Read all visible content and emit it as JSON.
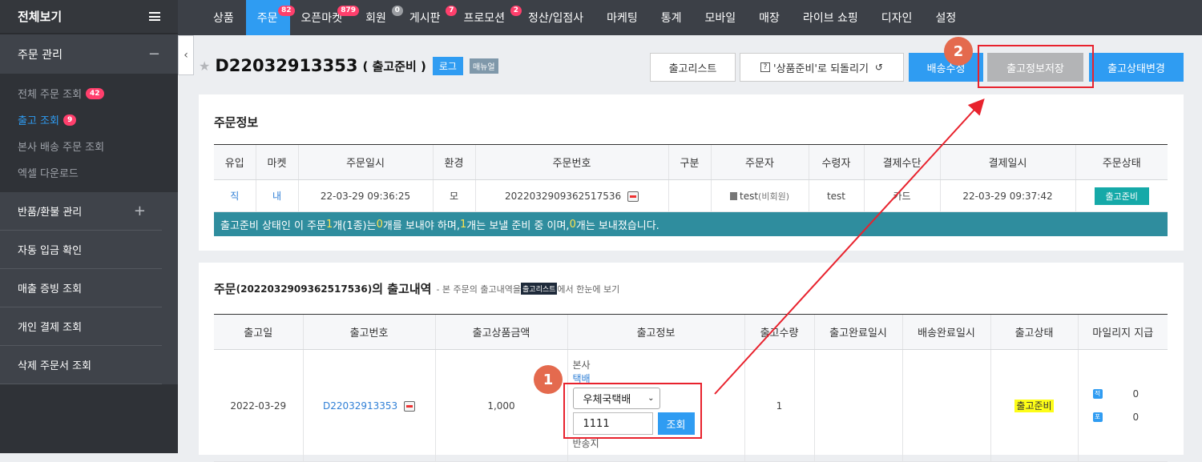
{
  "sidebar": {
    "title": "전체보기",
    "section_order": "주문 관리",
    "section_order_sign": "−",
    "sub_items": [
      {
        "label": "전체 주문 조회",
        "badge": "42"
      },
      {
        "label": "출고 조회",
        "badge": "9"
      },
      {
        "label": "본사 배송 주문 조회",
        "badge": ""
      },
      {
        "label": "엑셀 다운로드",
        "badge": ""
      }
    ],
    "main_items": [
      {
        "label": "반품/환불 관리",
        "sign": "+"
      },
      {
        "label": "자동 입금 확인",
        "sign": ""
      },
      {
        "label": "매출 증빙 조회",
        "sign": ""
      },
      {
        "label": "개인 결제 조회",
        "sign": ""
      },
      {
        "label": "삭제 주문서 조회",
        "sign": ""
      }
    ]
  },
  "topnav": [
    {
      "label": "상품",
      "badge": ""
    },
    {
      "label": "주문",
      "badge": "82"
    },
    {
      "label": "오픈마켓",
      "badge": "879"
    },
    {
      "label": "회원",
      "badge": "0"
    },
    {
      "label": "게시판",
      "badge": "7"
    },
    {
      "label": "프로모션",
      "badge": "2"
    },
    {
      "label": "정산/입점사",
      "badge": ""
    },
    {
      "label": "마케팅",
      "badge": ""
    },
    {
      "label": "통계",
      "badge": ""
    },
    {
      "label": "모바일",
      "badge": ""
    },
    {
      "label": "매장",
      "badge": ""
    },
    {
      "label": "라이브 쇼핑",
      "badge": ""
    },
    {
      "label": "디자인",
      "badge": ""
    },
    {
      "label": "설정",
      "badge": ""
    }
  ],
  "header": {
    "order_id": "D22032913353",
    "status": "( 출고준비 )",
    "log_label": "로그",
    "manual_label": "매뉴얼",
    "btn_list": "출고리스트",
    "btn_revert": "'상품준비'로 되돌리기",
    "btn_ship_edit": "배송수정",
    "btn_save": "출고정보저장",
    "btn_change": "출고상태변경"
  },
  "order_info": {
    "title": "주문정보",
    "columns": [
      "유입",
      "마켓",
      "주문일시",
      "환경",
      "주문번호",
      "구분",
      "주문자",
      "수령자",
      "결제수단",
      "결제일시",
      "주문상태"
    ],
    "row": {
      "inflow": "직",
      "market": "내",
      "order_date": "22-03-29 09:36:25",
      "env": "모",
      "order_no": "2022032909362517536",
      "type": "",
      "orderer": "test",
      "orderer_note": "(비회원)",
      "receiver": "test",
      "payment": "카드",
      "paid_at": "22-03-29 09:37:42",
      "status": "출고준비"
    },
    "notice": {
      "p1": "출고준비 상태인 이 주문 ",
      "n1": "1",
      "p2": "개(1종)는 ",
      "n2": "0",
      "p3": "개를 보내야  하며, ",
      "n3": "1",
      "p4": "개는 보낼 준비 중 이며, ",
      "n4": "0",
      "p5": "개는 보내졌습니다."
    }
  },
  "shipment": {
    "title_prefix": "주문",
    "title_order": "(2022032909362517536)",
    "title_suffix": "의 출고내역",
    "desc_prefix": "- 본 주문의 출고내역을",
    "desc_tag": "출고리스트",
    "desc_suffix": "에서 한눈에 보기",
    "columns": [
      "출고일",
      "출고번호",
      "출고상품금액",
      "출고정보",
      "출고수량",
      "출고완료일시",
      "배송완료일시",
      "출고상태",
      "마일리지 지급"
    ],
    "row": {
      "date": "2022-03-29",
      "ship_no": "D22032913353",
      "amount": "1,000",
      "origin": "본사",
      "method": "택배",
      "courier": "우체국택배",
      "tracking": "1111",
      "lookup": "조회",
      "return_label": "반송지",
      "qty": "1",
      "done_at": "",
      "delivered_at": "",
      "status": "출고준비",
      "mileage": [
        {
          "icon": "적",
          "value": "0"
        },
        {
          "icon": "포",
          "value": "0"
        }
      ]
    }
  },
  "annotations": [
    "1",
    "2"
  ],
  "colors": {
    "accent": "#2f9cf2",
    "badge": "#ff3f6c",
    "notice": "#2f8d9e",
    "annotation": "#e8222d"
  }
}
